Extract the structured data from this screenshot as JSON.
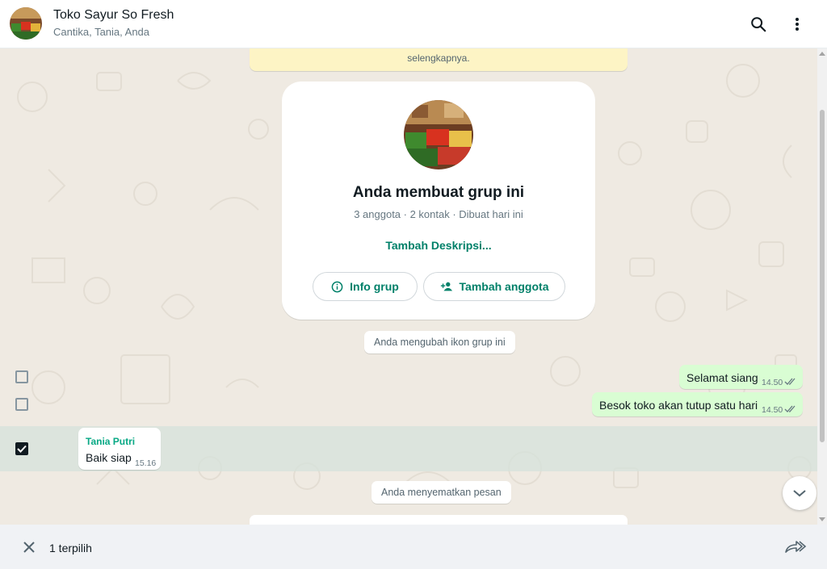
{
  "header": {
    "title": "Toko Sayur So Fresh",
    "subtitle": "Cantika, Tania, Anda",
    "icons": [
      "search-icon",
      "menu-icon"
    ]
  },
  "chat": {
    "top_notice": "selengkapnya.",
    "group_card": {
      "title": "Anda membuat grup ini",
      "subtitle": "3 anggota · 2 kontak · Dibuat hari ini",
      "add_description": "Tambah Deskripsi...",
      "info_button": "Info grup",
      "add_member_button": "Tambah anggota"
    },
    "system_messages": {
      "icon_changed": "Anda mengubah ikon grup ini",
      "pinned": "Anda menyematkan pesan"
    },
    "messages": [
      {
        "direction": "out",
        "text": "Selamat siang",
        "time": "14.50",
        "selected": false
      },
      {
        "direction": "out",
        "text": "Besok toko akan tutup satu hari",
        "time": "14.50",
        "selected": false
      },
      {
        "direction": "in",
        "sender": "Tania Putri",
        "text": "Baik siap",
        "time": "15.16",
        "selected": true
      }
    ]
  },
  "footer": {
    "selected_count": "1 terpilih"
  },
  "colors": {
    "accent": "#008069",
    "sender": "#06a884",
    "outgoing_bubble": "#d9fdd3",
    "chat_background": "#efeae2"
  }
}
